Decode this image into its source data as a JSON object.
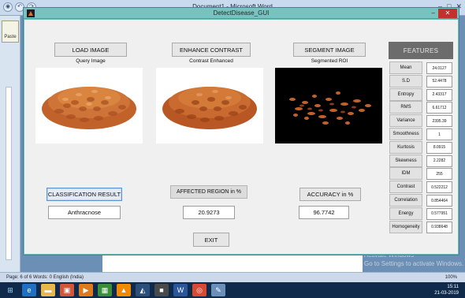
{
  "word": {
    "title": "Document1 - Microsoft Word",
    "paste_label": "Paste",
    "status": "Page: 6 of 6   Words: 0   English (India)",
    "zoom": "100%",
    "watermark_line1": "Activate Windows",
    "watermark_line2": "Go to Settings to activate Windows."
  },
  "taskbar": {
    "time": "15:11",
    "date": "21-03-2019"
  },
  "figure": {
    "title": "DetectDisease_GUI",
    "close_symbol": "✕",
    "min_symbol": "–"
  },
  "buttons": {
    "load": "LOAD IMAGE",
    "enhance": "ENHANCE CONTRAST",
    "segment": "SEGMENT IMAGE",
    "classify": "CLASSIFICATION RESULT",
    "accuracy": "ACCURACY in %",
    "exit": "EXIT"
  },
  "images": {
    "query_label": "Query Image",
    "enhanced_label": "Contrast Enhanced",
    "segmented_label": "Segmented ROI"
  },
  "results": {
    "affected_header": "AFFECTED REGION in %",
    "classification_value": "Anthracnose",
    "affected_value": "20.9273",
    "accuracy_value": "96.7742"
  },
  "features": {
    "header": "FEATURES",
    "rows": [
      {
        "name": "Mean",
        "value": "24.0127"
      },
      {
        "name": "S.D",
        "value": "52.4478"
      },
      {
        "name": "Entropy",
        "value": "2.43317"
      },
      {
        "name": "RMS",
        "value": "6.61712"
      },
      {
        "name": "Variance",
        "value": "2395.39"
      },
      {
        "name": "Smoothness",
        "value": "1"
      },
      {
        "name": "Kurtosis",
        "value": "8.0915"
      },
      {
        "name": "Skewness",
        "value": "2.2282"
      },
      {
        "name": "IDM",
        "value": "255"
      },
      {
        "name": "Contrast",
        "value": "0.522212"
      },
      {
        "name": "Correlation",
        "value": "0.854464"
      },
      {
        "name": "Energy",
        "value": "0.577951"
      },
      {
        "name": "Homogeneity",
        "value": "0.938648"
      }
    ]
  },
  "colors": {
    "figure_frame": "#69bdb9",
    "peanut": "#c2622a",
    "close": "#c4302b"
  }
}
